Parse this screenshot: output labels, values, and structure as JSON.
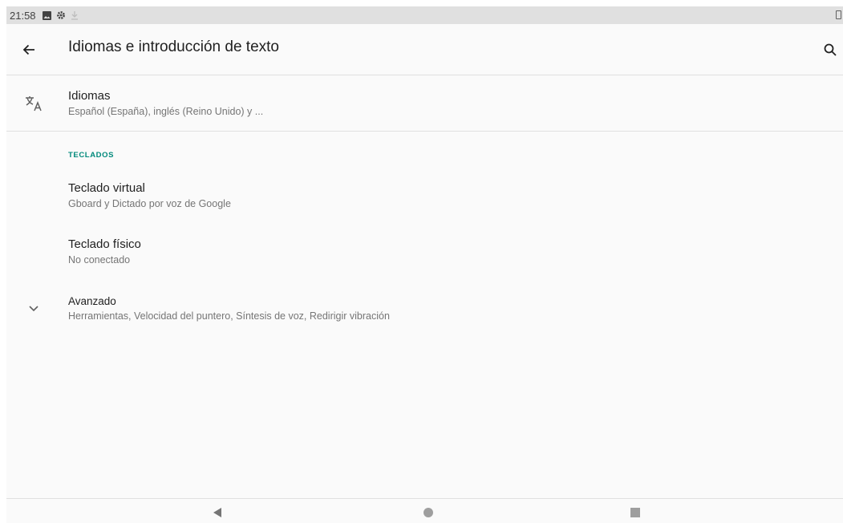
{
  "status_bar": {
    "time": "21:58",
    "icons": [
      "image-icon",
      "gear-icon",
      "download-icon",
      "battery-icon"
    ]
  },
  "app_bar": {
    "title": "Idiomas e introducción de texto",
    "back_icon": "arrow-back-icon",
    "search_icon": "search-icon"
  },
  "items": {
    "languages": {
      "icon": "translate-icon",
      "title": "Idiomas",
      "summary": "Español (España), inglés (Reino Unido) y ..."
    },
    "virtual_keyboard": {
      "title": "Teclado virtual",
      "summary": "Gboard y Dictado por voz de Google"
    },
    "physical_keyboard": {
      "title": "Teclado físico",
      "summary": "No conectado"
    },
    "advanced": {
      "icon": "chevron-down-icon",
      "title": "Avanzado",
      "summary": "Herramientas, Velocidad del puntero, Síntesis de voz, Redirigir vibración"
    }
  },
  "section_header": "TECLADOS",
  "colors": {
    "accent": "#00897b",
    "primary_text": "#212121",
    "secondary_text": "#757575",
    "background": "#fafafa"
  },
  "nav_bar": {
    "icons": [
      "nav-back-icon",
      "nav-home-icon",
      "nav-recents-icon"
    ]
  }
}
